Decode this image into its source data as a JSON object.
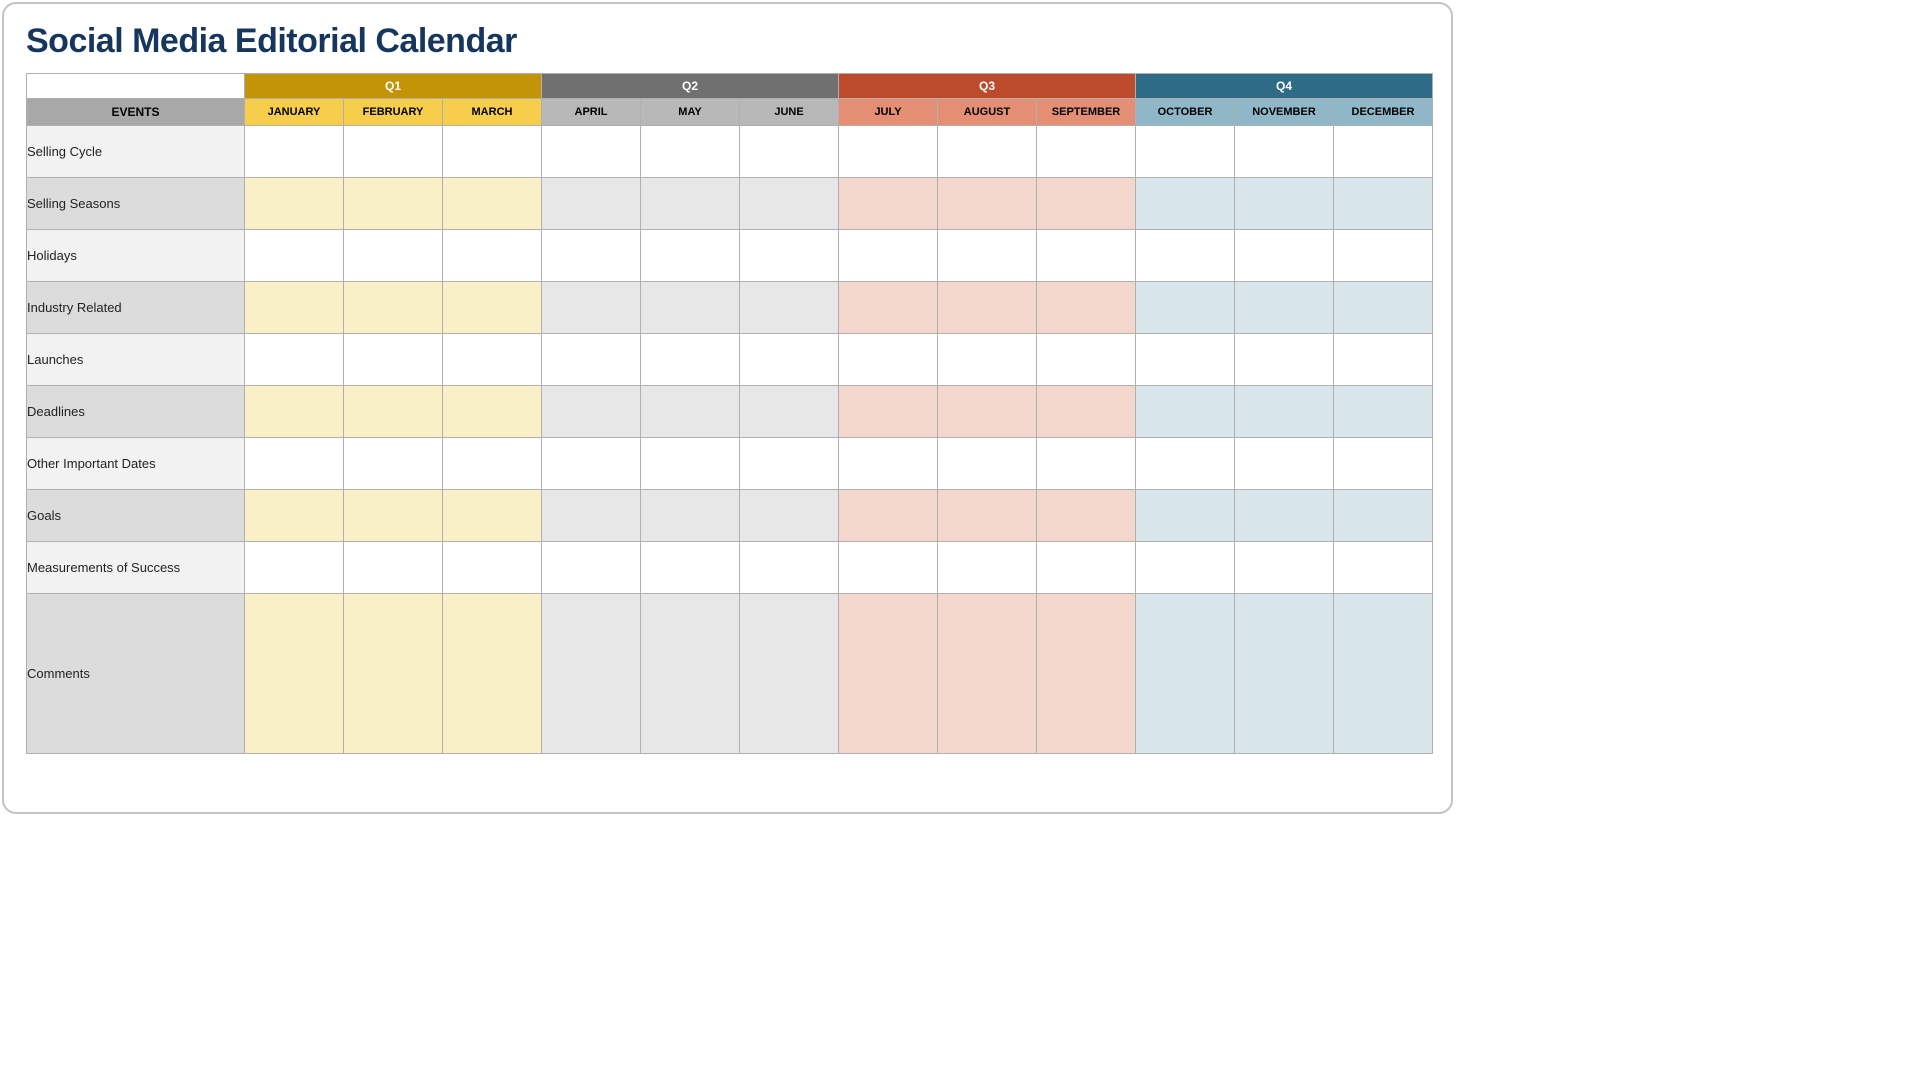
{
  "title": "Social Media Editorial Calendar",
  "header": {
    "events_label": "EVENTS",
    "quarters": [
      {
        "label": "Q1",
        "months": [
          "JANUARY",
          "FEBRUARY",
          "MARCH"
        ]
      },
      {
        "label": "Q2",
        "months": [
          "APRIL",
          "MAY",
          "JUNE"
        ]
      },
      {
        "label": "Q3",
        "months": [
          "JULY",
          "AUGUST",
          "SEPTEMBER"
        ]
      },
      {
        "label": "Q4",
        "months": [
          "OCTOBER",
          "NOVEMBER",
          "DECEMBER"
        ]
      }
    ]
  },
  "rows": [
    {
      "label": "Selling Cycle",
      "tinted": false,
      "tall": false
    },
    {
      "label": "Selling Seasons",
      "tinted": true,
      "tall": false
    },
    {
      "label": "Holidays",
      "tinted": false,
      "tall": false
    },
    {
      "label": "Industry Related",
      "tinted": true,
      "tall": false
    },
    {
      "label": "Launches",
      "tinted": false,
      "tall": false
    },
    {
      "label": "Deadlines",
      "tinted": true,
      "tall": false
    },
    {
      "label": "Other Important Dates",
      "tinted": false,
      "tall": false
    },
    {
      "label": "Goals",
      "tinted": true,
      "tall": false
    },
    {
      "label": "Measurements of Success",
      "tinted": false,
      "tall": false
    },
    {
      "label": "Comments",
      "tinted": true,
      "tall": true
    }
  ]
}
